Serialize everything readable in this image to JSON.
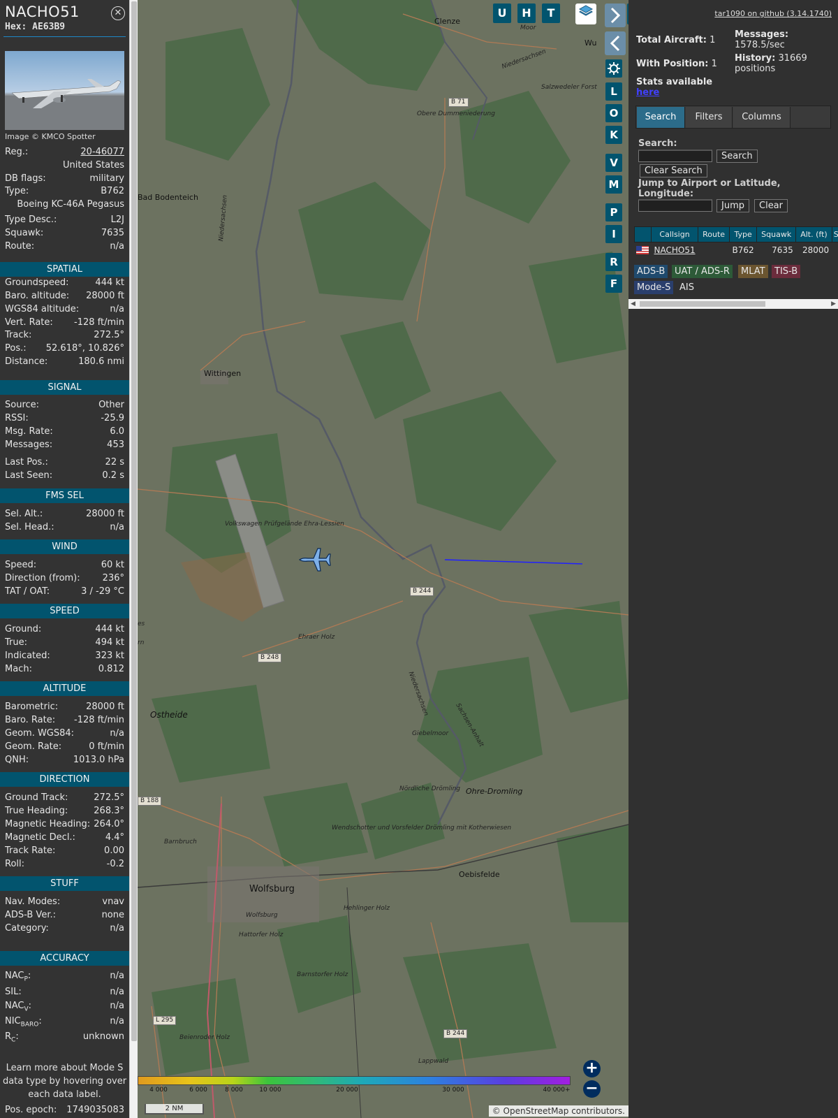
{
  "info": {
    "callsign": "NACHO51",
    "hex_label": "Hex:",
    "hex": "AE63B9",
    "photo_credit": "Image © KMCO Spotter",
    "registration_label": "Reg.:",
    "registration": "20-46077",
    "country": "United States",
    "db_flags_label": "DB flags:",
    "db_flags": "military",
    "type_label": "Type:",
    "type": "B762",
    "type_name": "Boeing KC-46A Pegasus",
    "type_desc_label": "Type Desc.:",
    "type_desc": "L2J",
    "squawk_label": "Squawk:",
    "squawk": "7635",
    "route_label": "Route:",
    "route": "n/a"
  },
  "sections": {
    "spatial": "SPATIAL",
    "signal": "SIGNAL",
    "fms": "FMS SEL",
    "wind": "WIND",
    "speed": "SPEED",
    "altitude": "ALTITUDE",
    "direction": "DIRECTION",
    "stuff": "STUFF",
    "accuracy": "ACCURACY"
  },
  "spatial": [
    {
      "label": "Groundspeed:",
      "value": "444 kt"
    },
    {
      "label": "Baro. altitude:",
      "value": "28000 ft"
    },
    {
      "label": "WGS84 altitude:",
      "value": "n/a"
    },
    {
      "label": "Vert. Rate:",
      "value": "-128 ft/min"
    },
    {
      "label": "Track:",
      "value": "272.5°"
    },
    {
      "label": "Pos.:",
      "value": "52.618°, 10.826°"
    },
    {
      "label": "Distance:",
      "value": "180.6 nmi"
    }
  ],
  "signal": [
    {
      "label": "Source:",
      "value": "Other"
    },
    {
      "label": "RSSI:",
      "value": "-25.9"
    },
    {
      "label": "Msg. Rate:",
      "value": "6.0"
    },
    {
      "label": "Messages:",
      "value": "453"
    },
    {
      "label": "Last Pos.:",
      "value": "22 s"
    },
    {
      "label": "Last Seen:",
      "value": "0.2 s"
    }
  ],
  "fms": [
    {
      "label": "Sel. Alt.:",
      "value": "28000 ft"
    },
    {
      "label": "Sel. Head.:",
      "value": "n/a"
    }
  ],
  "wind": [
    {
      "label": "Speed:",
      "value": "60 kt"
    },
    {
      "label": "Direction (from):",
      "value": "236°"
    },
    {
      "label": "TAT / OAT:",
      "value": "3 / -29 °C"
    }
  ],
  "speed": [
    {
      "label": "Ground:",
      "value": "444 kt"
    },
    {
      "label": "True:",
      "value": "494 kt"
    },
    {
      "label": "Indicated:",
      "value": "323 kt"
    },
    {
      "label": "Mach:",
      "value": "0.812"
    }
  ],
  "altitude": [
    {
      "label": "Barometric:",
      "value": "28000 ft"
    },
    {
      "label": "Baro. Rate:",
      "value": "-128 ft/min"
    },
    {
      "label": "Geom. WGS84:",
      "value": "n/a"
    },
    {
      "label": "Geom. Rate:",
      "value": "0 ft/min"
    },
    {
      "label": "QNH:",
      "value": "1013.0 hPa"
    }
  ],
  "direction": [
    {
      "label": "Ground Track:",
      "value": "272.5°"
    },
    {
      "label": "True Heading:",
      "value": "268.3°"
    },
    {
      "label": "Magnetic Heading:",
      "value": "264.0°"
    },
    {
      "label": "Magnetic Decl.:",
      "value": "4.4°"
    },
    {
      "label": "Track Rate:",
      "value": "0.00"
    },
    {
      "label": "Roll:",
      "value": "-0.2"
    }
  ],
  "stuff": [
    {
      "label": "Nav. Modes:",
      "value": "vnav"
    },
    {
      "label": "ADS-B Ver.:",
      "value": "none"
    },
    {
      "label": "Category:",
      "value": "n/a"
    }
  ],
  "accuracy": {
    "nacp_base": "NAC",
    "nacp_sub": "P",
    "nacp_suffix": ":",
    "nacp": "n/a",
    "sil_label": "SIL:",
    "sil": "n/a",
    "nacv_base": "NAC",
    "nacv_sub": "V",
    "nacv_suffix": ":",
    "nacv": "n/a",
    "nic_base": "NIC",
    "nic_sub": "BARO",
    "nic_suffix": ":",
    "nic": "n/a",
    "rc_base": "R",
    "rc_sub": "C",
    "rc_suffix": ":",
    "rc": "unknown"
  },
  "learn_more": "Learn more about Mode S data type by hovering over each data label.",
  "epoch_label": "Pos. epoch:",
  "epoch": "1749035083",
  "map": {
    "toolbar": [
      "U",
      "H",
      "T"
    ],
    "side_buttons": [
      "L",
      "O",
      "K",
      "V",
      "M",
      "P",
      "I",
      "R",
      "F"
    ],
    "places": {
      "clenze": "Clenze",
      "bad_bodenteich": "Bad Bodenteich",
      "wittingen": "Wittingen",
      "wolfsburg": "Wolfsburg",
      "oebisfelde": "Oebisfelde",
      "ostheide": "Ostheide",
      "ohre_dromling": "Ohre-Dromling",
      "barnbruch": "Barnbruch",
      "moor": "Moor",
      "salzwedeler": "Salzwedeler Forst",
      "obere_dumme": "Obere Dummeniederung",
      "volkswagen": "Volkswagen Prüfgelände Ehra-Lessien",
      "ehraer": "Ehraer Holz",
      "giebelmoor": "Giebelmoor",
      "nordliche": "Nördliche Drömling",
      "wendschotter": "Wendschotter und Vorsfelder Drömling mit Kotherwiesen",
      "hehlinger": "Hehlinger Holz",
      "hattorfer": "Hattorfer Holz",
      "barnstorfer": "Barnstorfer Holz",
      "beienroder": "Beienroder Holz",
      "lappwald": "Lappwald",
      "wolfsburg_small": "Wolfsburg",
      "niedersachsen1": "Niedersachsen",
      "niedersachsen2": "Niedersachsen",
      "niedersachsen3": "Niedersachsen",
      "sachsen_anhalt": "Sachsen-Anhalt",
      "wu": "Wu",
      "es": "es",
      "rn": "rn"
    },
    "roads": {
      "b71": "B 71",
      "b244a": "B 244",
      "b248": "B 248",
      "b188": "B 188",
      "l295": "L 295",
      "b244b": "B 244"
    },
    "altitude_ticks": [
      "4 000",
      "6 000",
      "8 000",
      "10 000",
      "20 000",
      "30 000",
      "40 000+"
    ],
    "scale": "2 NM",
    "attribution": "© OpenStreetMap contributors."
  },
  "stats": {
    "version_link": "tar1090 on github (3.14.1740)",
    "total_label": "Total Aircraft:",
    "total": "1",
    "position_label": "With Position:",
    "position": "1",
    "stats_label": "Stats available",
    "stats_link": "here",
    "messages_label": "Messages:",
    "messages": "1578.5/sec",
    "history_label": "History:",
    "history": "31669 positions"
  },
  "tabs": [
    "Search",
    "Filters",
    "Columns"
  ],
  "search": {
    "label": "Search:",
    "button": "Search",
    "clear": "Clear Search",
    "jump_label": "Jump to Airport or Latitude, Longitude:",
    "jump_button": "Jump",
    "jump_clear": "Clear"
  },
  "table": {
    "headers": [
      "Callsign",
      "Route",
      "Type",
      "Squawk",
      "Alt. (ft)",
      "Sp"
    ],
    "rows": [
      {
        "callsign": "NACHO51",
        "route": "",
        "type": "B762",
        "squawk": "7635",
        "alt": "28000"
      }
    ]
  },
  "sources": [
    {
      "label": "ADS-B",
      "color": "#1f4a6d"
    },
    {
      "label": "UAT / ADS-R",
      "color": "#2d5a38"
    },
    {
      "label": "MLAT",
      "color": "#6b5530"
    },
    {
      "label": "TIS-B",
      "color": "#6b2c3c"
    },
    {
      "label": "Mode-S",
      "color": "#2a3f6d"
    },
    {
      "label": "AIS",
      "color": "#303030"
    }
  ],
  "colors": {
    "accent": "#02546e",
    "track": "#2020ff",
    "aircraft": "#7eb0e8"
  }
}
